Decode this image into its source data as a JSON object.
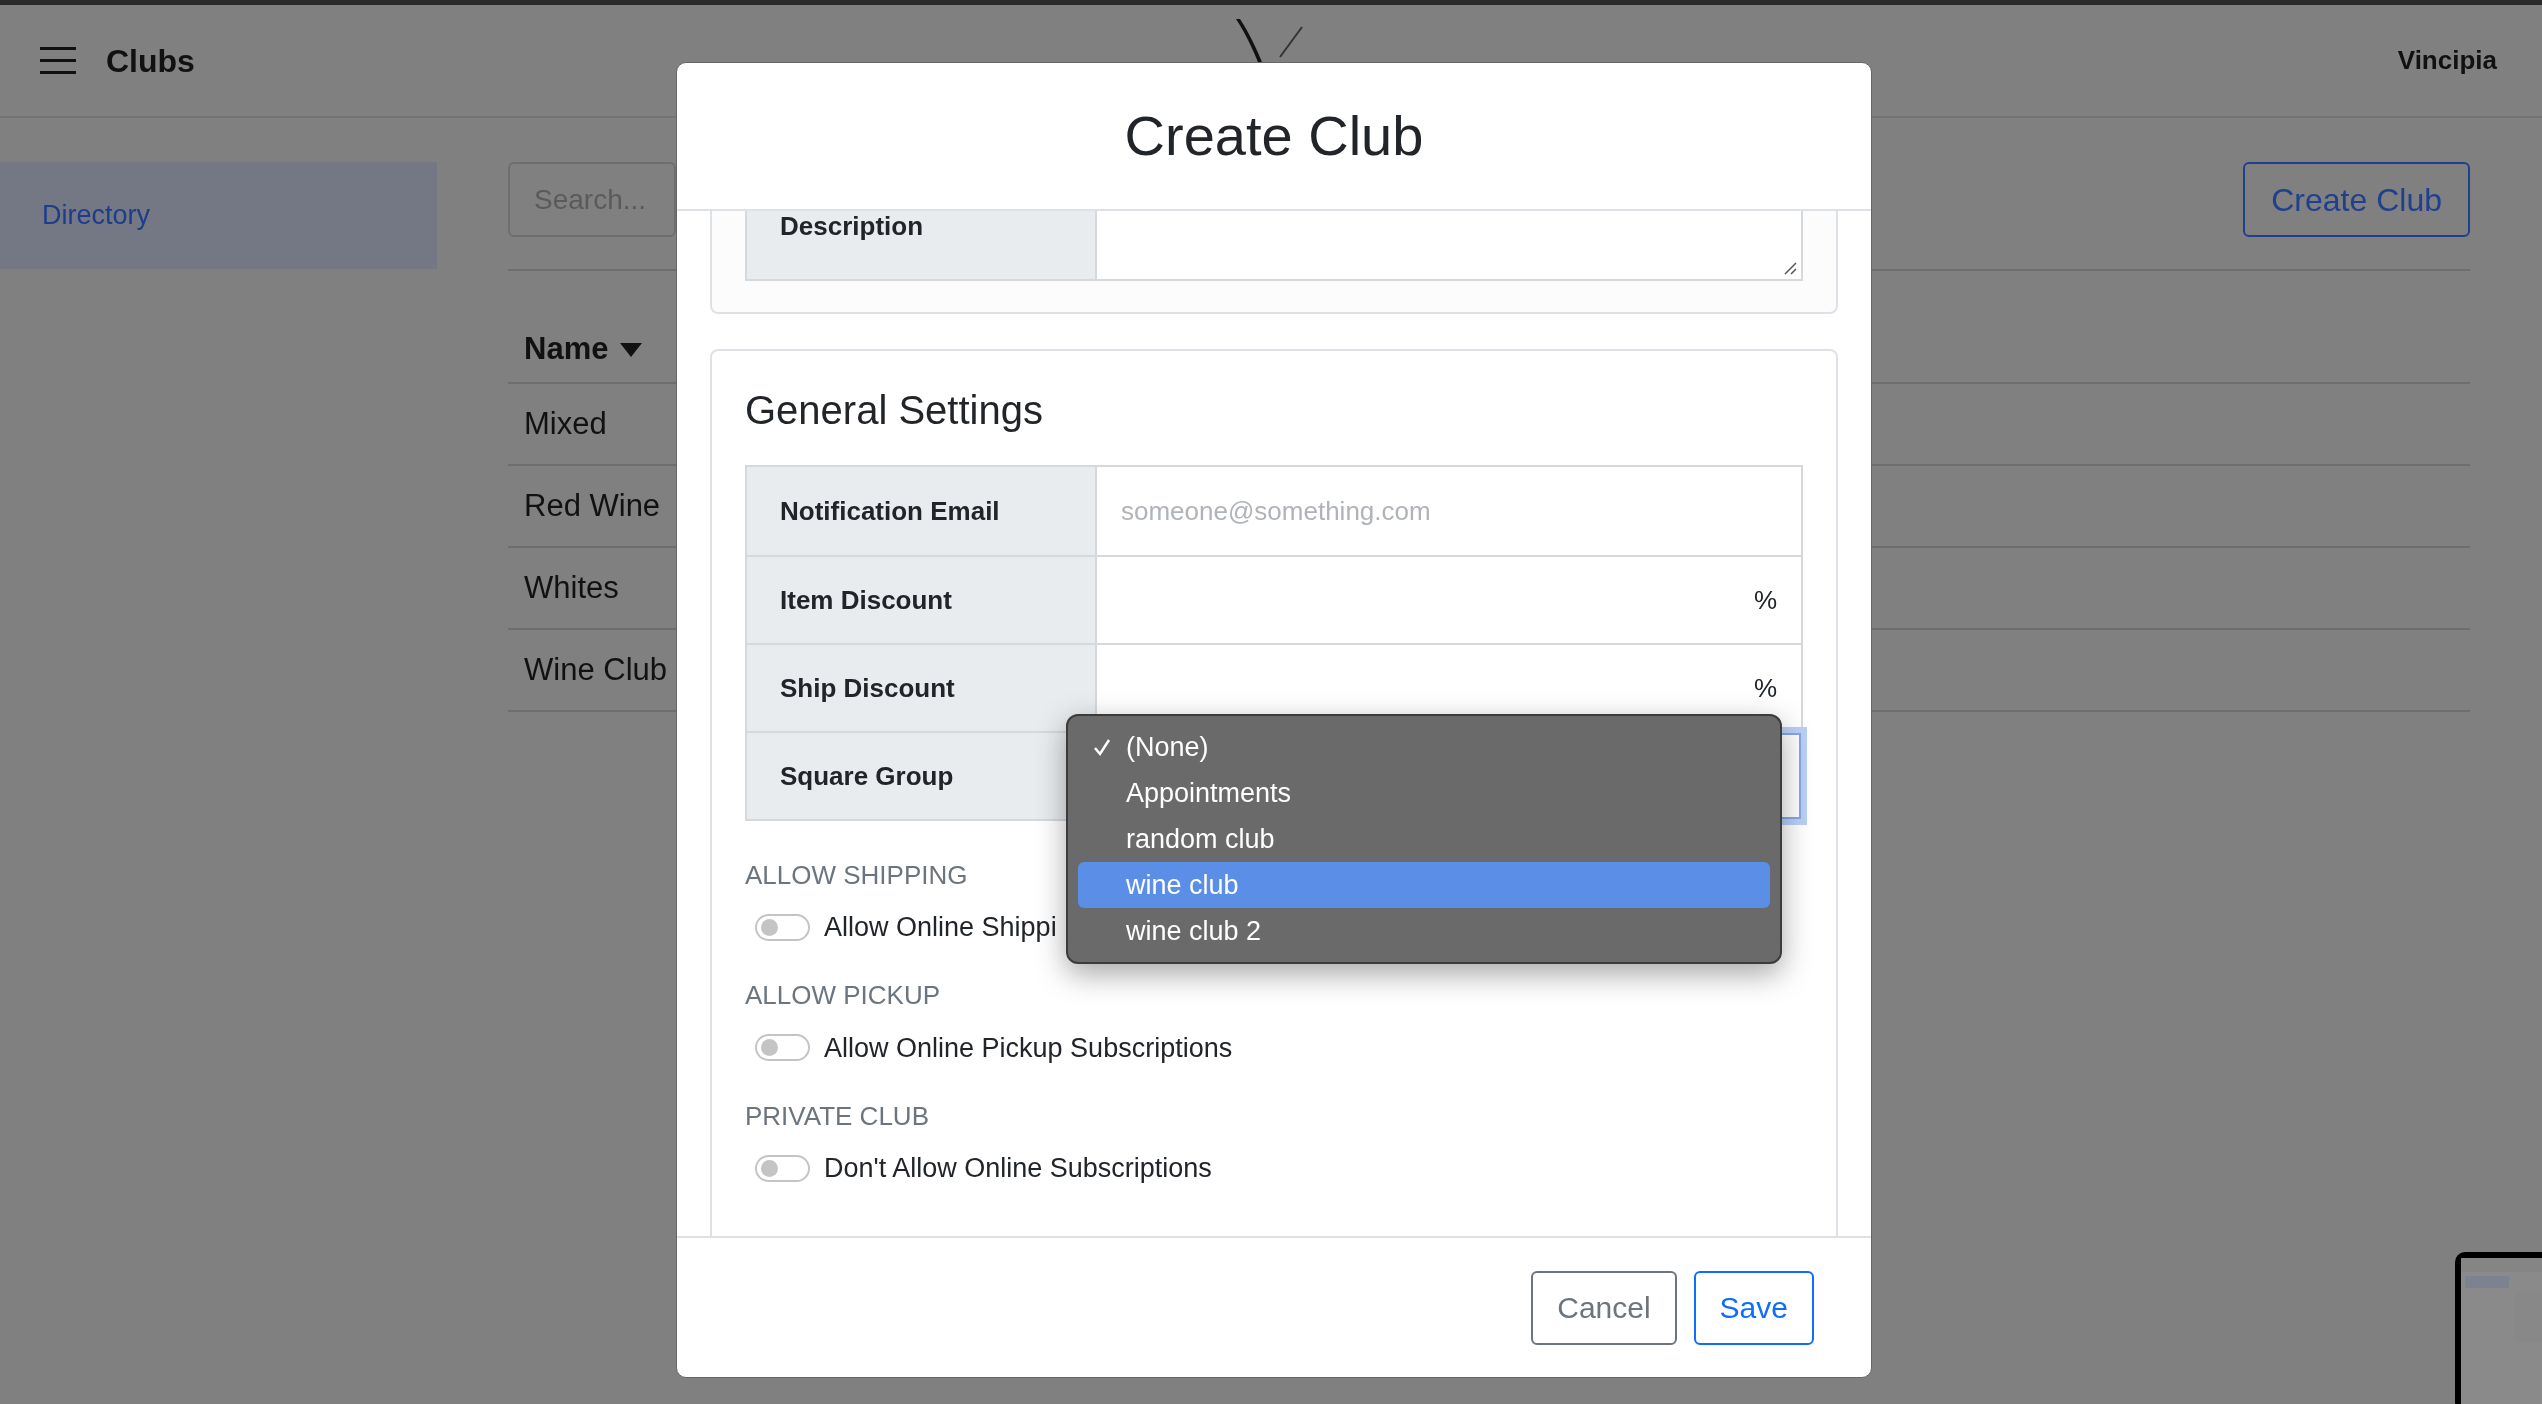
{
  "header": {
    "title": "Clubs",
    "account": "Vincipia"
  },
  "sidebar": {
    "items": [
      {
        "label": "Directory",
        "selected": true
      }
    ]
  },
  "toolbar": {
    "search": {
      "placeholder": "Search..."
    },
    "create_button": "Create Club"
  },
  "table": {
    "columns": [
      {
        "label": "Name",
        "sorted": true
      }
    ],
    "rows": [
      {
        "name": "Mixed"
      },
      {
        "name": "Red Wine"
      },
      {
        "name": "Whites"
      },
      {
        "name": "Wine Club"
      }
    ]
  },
  "modal": {
    "title": "Create Club",
    "description": {
      "label": "Description"
    },
    "general_settings": {
      "title": "General Settings",
      "fields": [
        {
          "kind": "email",
          "label": "Notification Email",
          "placeholder": "someone@something.com"
        },
        {
          "kind": "percent",
          "label": "Item Discount",
          "suffix": "%"
        },
        {
          "kind": "percent",
          "label": "Ship Discount",
          "suffix": "%"
        },
        {
          "kind": "select",
          "label": "Square Group"
        }
      ],
      "toggles": [
        {
          "heading": "ALLOW SHIPPING",
          "label": "Allow Online Shippi",
          "on": false
        },
        {
          "heading": "ALLOW PICKUP",
          "label": "Allow Online Pickup Subscriptions",
          "on": false
        },
        {
          "heading": "PRIVATE CLUB",
          "label": "Don't Allow Online Subscriptions",
          "on": false
        }
      ]
    },
    "dropdown": {
      "options": [
        {
          "label": "(None)",
          "checked": true,
          "selected": false
        },
        {
          "label": "Appointments",
          "checked": false,
          "selected": false
        },
        {
          "label": "random club",
          "checked": false,
          "selected": false
        },
        {
          "label": "wine club",
          "checked": false,
          "selected": true
        },
        {
          "label": "wine club 2",
          "checked": false,
          "selected": false
        }
      ]
    },
    "buttons": [
      {
        "kind": "secondary",
        "label": "Cancel"
      },
      {
        "kind": "primary",
        "label": "Save"
      }
    ]
  }
}
